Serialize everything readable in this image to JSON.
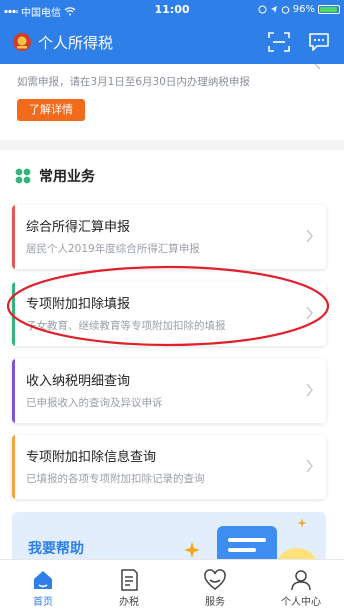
{
  "status_bar": {
    "carrier": "中国电信",
    "time": "11:00",
    "battery": "96%",
    "battery_level": 0.96
  },
  "header": {
    "title": "个人所得税",
    "icons": [
      "tax-emblem-icon",
      "scan-icon",
      "message-icon"
    ]
  },
  "notice": {
    "text": "如需申报，请在3月1日至6月30日内办理纳税申报",
    "button_label": "了解详情"
  },
  "common_services": {
    "title": "常用业务",
    "items": [
      {
        "title": "综合所得汇算申报",
        "subtitle": "居民个人2019年度综合所得汇算申报",
        "accent": "#e05a5a"
      },
      {
        "title": "专项附加扣除填报",
        "subtitle": "子女教育、继续教育等专项附加扣除的填报",
        "accent": "#35b37e"
      },
      {
        "title": "收入纳税明细查询",
        "subtitle": "已申报收入的查询及异议申诉",
        "accent": "#7b55d6"
      },
      {
        "title": "专项附加扣除信息查询",
        "subtitle": "已填报的各项专项附加扣除记录的查询",
        "accent": "#f2a63b"
      }
    ]
  },
  "help": {
    "title": "我要帮助"
  },
  "tabs": [
    {
      "label": "首页",
      "icon": "home-icon",
      "active": true
    },
    {
      "label": "办税",
      "icon": "form-icon",
      "active": false
    },
    {
      "label": "服务",
      "icon": "service-heart-icon",
      "active": false
    },
    {
      "label": "个人中心",
      "icon": "profile-icon",
      "active": false
    }
  ],
  "colors": {
    "brand": "#2f7fe8",
    "orange": "#f26b1d",
    "highlight_ring": "#e0202b"
  }
}
